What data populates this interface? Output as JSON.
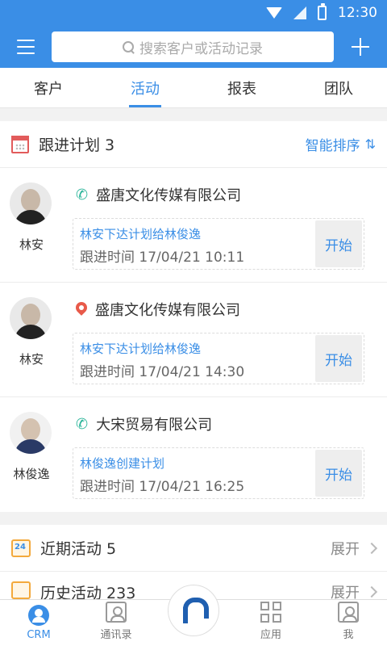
{
  "status_bar": {
    "time": "12:30"
  },
  "header": {
    "search_placeholder": "搜索客户或活动记录"
  },
  "tabs": [
    {
      "label": "客户"
    },
    {
      "label": "活动"
    },
    {
      "label": "报表"
    },
    {
      "label": "团队"
    }
  ],
  "active_tab": "活动",
  "plan": {
    "title": "跟进计划 3",
    "sort_label": "智能排序",
    "sort_icon": "⇅",
    "items": [
      {
        "person": "林安",
        "company": "盛唐文化传媒有限公司",
        "icon": "phone-icon",
        "desc": "林安下达计划给林俊逸",
        "time": "跟进时间 17/04/21 10:11",
        "button": "开始"
      },
      {
        "person": "林安",
        "company": "盛唐文化传媒有限公司",
        "icon": "location-pin-icon",
        "desc": "林安下达计划给林俊逸",
        "time": "跟进时间 17/04/21 14:30",
        "button": "开始"
      },
      {
        "person": "林俊逸",
        "company": "大宋贸易有限公司",
        "icon": "phone-icon",
        "desc": "林俊逸创建计划",
        "time": "跟进时间 17/04/21 16:25",
        "button": "开始"
      }
    ]
  },
  "recent": {
    "badge": "24",
    "title": "近期活动 5",
    "expand": "展开"
  },
  "history": {
    "title": "历史活动 233",
    "expand": "展开"
  },
  "bottom_nav": [
    {
      "label": "CRM"
    },
    {
      "label": "通讯录"
    },
    {
      "label": ""
    },
    {
      "label": "应用"
    },
    {
      "label": "我"
    }
  ],
  "colors": {
    "accent": "#3a8ee6",
    "phone": "#2bb59a",
    "pin": "#e85a4a"
  }
}
